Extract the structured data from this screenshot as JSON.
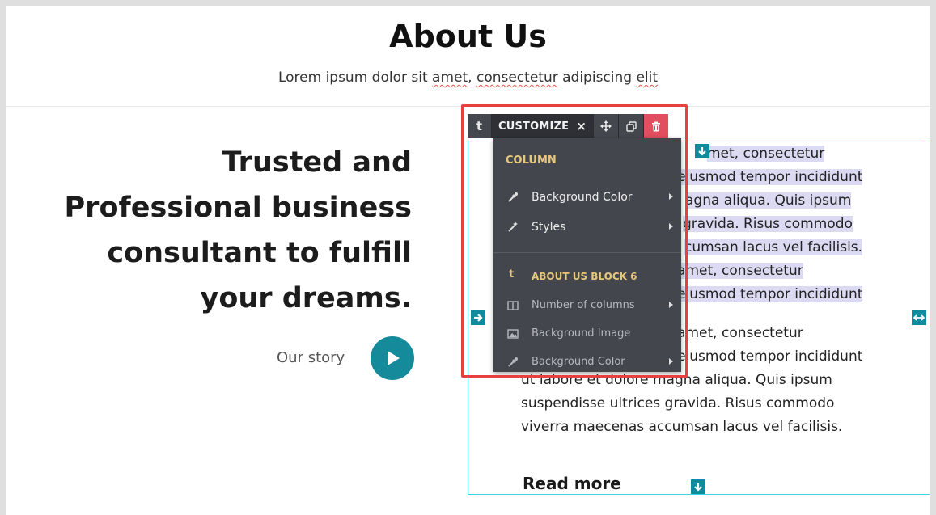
{
  "section": {
    "title": "About Us",
    "subtitle_parts": [
      "Lorem ipsum dolor sit ",
      "amet",
      ", ",
      "consectetur",
      " adipiscing ",
      "elit"
    ]
  },
  "left": {
    "headline_lines": [
      "Trusted and",
      "Professional business",
      "consultant to fulfill",
      "your dreams."
    ],
    "story_label": "Our story"
  },
  "right": {
    "paragraph1_lines": [
      "met, consectetur",
      "t eiusmod tempor incididunt",
      "agna aliqua. Quis ipsum",
      "gravida. Risus commodo",
      "cumsan lacus vel facilisis.",
      "t amet, consectetur",
      "t eiusmod tempor incididunt"
    ],
    "paragraph2_lines": [
      "t amet, consectetur",
      "t eiusmod tempor incididunt",
      "ut labore et dolore magna aliqua. Quis ipsum",
      "suspendisse ultrices gravida. Risus commodo",
      "viverra maecenas accumsan lacus vel facilisis."
    ],
    "read_more": "Read more"
  },
  "toolbar": {
    "type_glyph": "t",
    "customize_label": "CUSTOMIZE",
    "close_glyph": "×"
  },
  "menu": {
    "column_heading": "COLUMN",
    "column_items": [
      {
        "label": "Background Color",
        "icon": "eyedropper-icon"
      },
      {
        "label": "Styles",
        "icon": "magic-wand-icon"
      }
    ],
    "block_glyph": "t",
    "block_heading": "ABOUT US BLOCK 6",
    "block_items": [
      {
        "label": "Number of columns",
        "icon": "columns-icon"
      },
      {
        "label": "Background Image",
        "icon": "image-icon"
      },
      {
        "label": "Background Color",
        "icon": "eyedropper-icon"
      }
    ]
  },
  "colors": {
    "accent": "#158a9a",
    "frame": "#3ad3e3",
    "highlight": "#e8403f",
    "delete": "#e04e5f",
    "menu_bg": "#44464d",
    "menu_heading": "#e6c77d",
    "text_selection": "#dcd9f3"
  }
}
